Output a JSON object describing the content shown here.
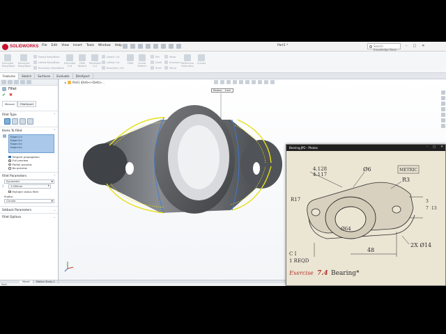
{
  "app": {
    "logo_text": "SOLIDWORKS",
    "menu": [
      "File",
      "Edit",
      "View",
      "Insert",
      "Tools",
      "Window",
      "Help"
    ],
    "document_title": "Part1 *",
    "search_placeholder": "Search Knowledge Base",
    "window_buttons": [
      "–",
      "□",
      "✕"
    ]
  },
  "commands": {
    "large": [
      {
        "label": "Extruded Boss/Base",
        "icon": "extrude-boss-icon"
      },
      {
        "label": "Revolved Boss/Base",
        "icon": "revolve-boss-icon"
      },
      {
        "label": "Extruded Cut",
        "icon": "extruded-cut-icon"
      },
      {
        "label": "Hole Wizard",
        "icon": "hole-wizard-icon"
      },
      {
        "label": "Revolved Cut",
        "icon": "revolved-cut-icon"
      },
      {
        "label": "Fillet",
        "icon": "fillet-icon"
      },
      {
        "label": "Linear Pattern",
        "icon": "linear-pattern-icon"
      },
      {
        "label": "Reference Geometry",
        "icon": "reference-geometry-icon"
      },
      {
        "label": "Curves",
        "icon": "curves-icon"
      }
    ],
    "small": [
      "Swept Boss/Base",
      "Lofted Boss/Base",
      "Boundary Boss/Base",
      "Swept Cut",
      "Lofted Cut",
      "Boundary Cut",
      "Rib",
      "Draft",
      "Shell",
      "Wrap",
      "Intersect",
      "Mirror"
    ]
  },
  "tabs": [
    "Features",
    "Sketch",
    "Surfaces",
    "Evaluate",
    "DimXpert"
  ],
  "active_tab": "Features",
  "property_manager": {
    "title": "Fillet",
    "mode_tabs": [
      "Manual",
      "FilletXpert"
    ],
    "fillet_type_label": "Fillet Type",
    "items_label": "Items To Fillet",
    "edges": [
      "Edge<1>",
      "Edge<2>",
      "Edge<3>",
      "Edge<4>"
    ],
    "tangent_propagation": "Tangent propagation",
    "preview_options": [
      "Full preview",
      "Partial preview",
      "No preview"
    ],
    "params_label": "Fillet Parameters",
    "method": "Symmetric",
    "radius_value": "1.000mm",
    "multiple_radius": "Multiple radius fillet",
    "profile_label": "Profile:",
    "profile_value": "Circular",
    "setback_label": "Setback Parameters",
    "options_label": "Fillet Options"
  },
  "bottom_tabs": [
    "Model",
    "Motion Study 1"
  ],
  "status_text": "Part1",
  "graphics": {
    "breadcrumb": "Part1 (Defa<<Defa>...",
    "callout": [
      "Radius:",
      "1mm"
    ]
  },
  "photos": {
    "title": "Bearing.JPG - Photos",
    "window_buttons": [
      "–",
      "□",
      "✕"
    ],
    "drawing_labels": {
      "dim_top1": "4.128",
      "dim_top2": "4.117",
      "dia6": "Ø6",
      "metric": "METRIC",
      "r3": "R3",
      "r17": "R17",
      "dia64": "Ø64",
      "hole": "2X Ø14",
      "width": "48",
      "side1": "3",
      "side2": "7",
      "side3": "13",
      "ci": "C I",
      "reqd": "1 REQD",
      "exercise_prefix": "Exercise",
      "exercise_num": "7.4",
      "exercise_name": "Bearing*"
    }
  }
}
